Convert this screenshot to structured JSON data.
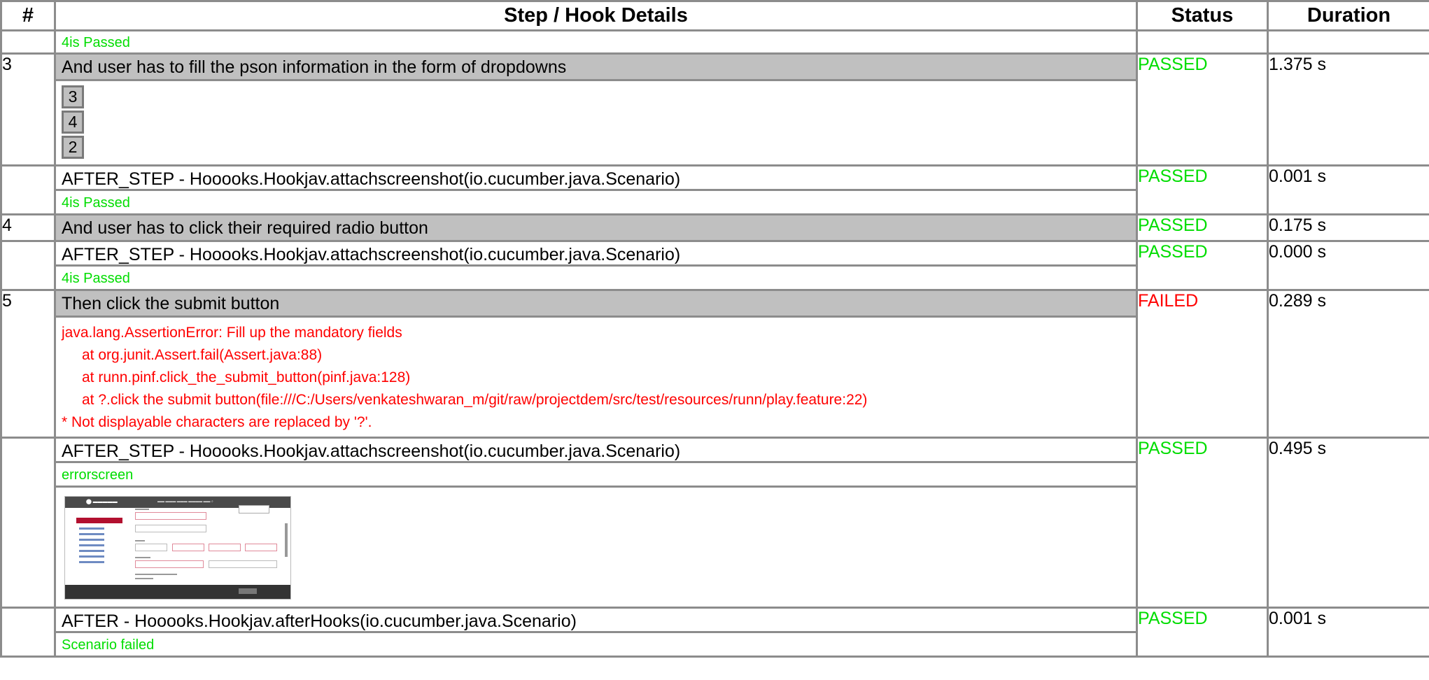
{
  "headers": {
    "num": "#",
    "details": "Step / Hook Details",
    "status": "Status",
    "duration": "Duration"
  },
  "rows": {
    "prev_log": "4is Passed",
    "step3": {
      "num": "3",
      "title": "And user has to fill the pson information in the form of dropdowns",
      "values": [
        "3",
        "4",
        "2"
      ],
      "status": "PASSED",
      "duration": "1.375 s"
    },
    "hook3": {
      "title": "AFTER_STEP - Hooooks.Hookjav.attachscreenshot(io.cucumber.java.Scenario)",
      "log": "4is Passed",
      "status": "PASSED",
      "duration": "0.001 s"
    },
    "step4": {
      "num": "4",
      "title": "And user has to click their required radio button",
      "status": "PASSED",
      "duration": "0.175 s"
    },
    "hook4": {
      "title": "AFTER_STEP - Hooooks.Hookjav.attachscreenshot(io.cucumber.java.Scenario)",
      "log": "4is Passed",
      "status": "PASSED",
      "duration": "0.000 s"
    },
    "step5": {
      "num": "5",
      "title": "Then click the submit button",
      "error": {
        "line1": "java.lang.AssertionError: Fill up the mandatory fields",
        "line2": "at org.junit.Assert.fail(Assert.java:88)",
        "line3": "at runn.pinf.click_the_submit_button(pinf.java:128)",
        "line4": "at ?.click the submit button(file:///C:/Users/venkateshwaran_m/git/raw/projectdem/src/test/resources/runn/play.feature:22)",
        "line5": "* Not displayable characters are replaced by '?'."
      },
      "status": "FAILED",
      "duration": "0.289 s"
    },
    "hook5": {
      "title": "AFTER_STEP - Hooooks.Hookjav.attachscreenshot(io.cucumber.java.Scenario)",
      "log": "errorscreen",
      "status": "PASSED",
      "duration": "0.495 s"
    },
    "after": {
      "title": "AFTER - Hooooks.Hookjav.afterHooks(io.cucumber.java.Scenario)",
      "log": "Scenario failed",
      "status": "PASSED",
      "duration": "0.001 s"
    }
  },
  "colors": {
    "passed": "#00dd00",
    "failed": "#ff0000",
    "step_bg": "#c0c0c0",
    "border": "#8c8c8c"
  }
}
